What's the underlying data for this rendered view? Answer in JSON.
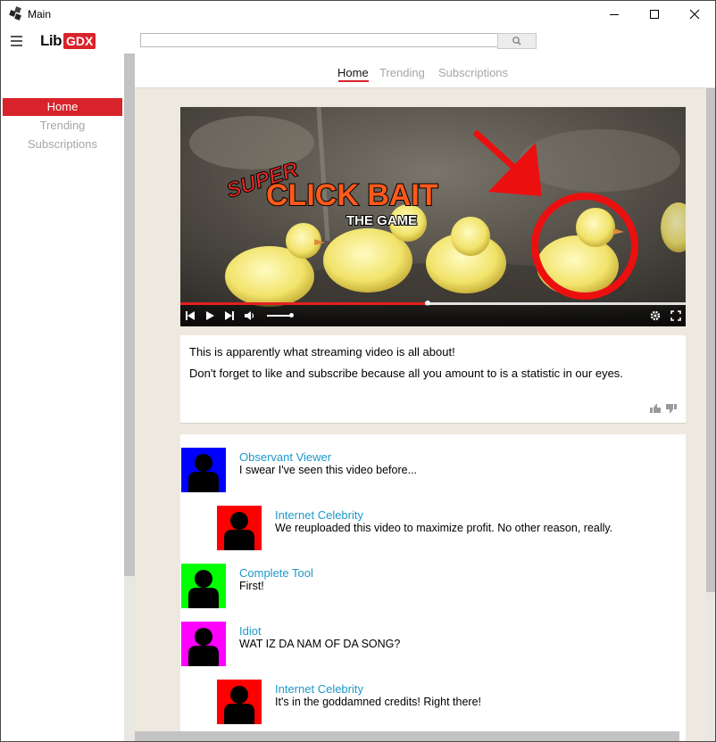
{
  "window": {
    "title": "Main"
  },
  "logo": {
    "part1": "Lib",
    "part2": "GDX"
  },
  "search": {
    "value": "",
    "placeholder": ""
  },
  "sidebar": {
    "items": [
      {
        "label": "Home",
        "active": true
      },
      {
        "label": "Trending",
        "active": false
      },
      {
        "label": "Subscriptions",
        "active": false
      }
    ]
  },
  "tabs": [
    {
      "label": "Home",
      "active": true
    },
    {
      "label": "Trending",
      "active": false
    },
    {
      "label": "Subscriptions",
      "active": false
    }
  ],
  "video": {
    "overlay": {
      "super": "SUPER",
      "headline": "CLICK BAIT",
      "sub": "THE GAME"
    },
    "progress": 0.49
  },
  "description": {
    "line1": "This is apparently what streaming video is all about!",
    "line2": "Don't forget to like and subscribe because all you amount to is a statistic in our eyes."
  },
  "comments": [
    {
      "name": "Observant Viewer",
      "text": "I swear I've seen this video before...",
      "avatar_color": "#0000ff",
      "reply": false
    },
    {
      "name": "Internet Celebrity",
      "text": "We reuploaded this video to maximize profit. No other reason, really.",
      "avatar_color": "#ff0000",
      "reply": true
    },
    {
      "name": "Complete Tool",
      "text": "First!",
      "avatar_color": "#00ff00",
      "reply": false
    },
    {
      "name": "Idiot",
      "text": "WAT IZ DA NAM OF DA SONG?",
      "avatar_color": "#ff00ff",
      "reply": false
    },
    {
      "name": "Internet Celebrity",
      "text": "It's in the goddamned credits! Right there!",
      "avatar_color": "#ff0000",
      "reply": true
    }
  ],
  "colors": {
    "accent": "#d8232a",
    "link": "#1e98c9",
    "background": "#ede9df"
  }
}
